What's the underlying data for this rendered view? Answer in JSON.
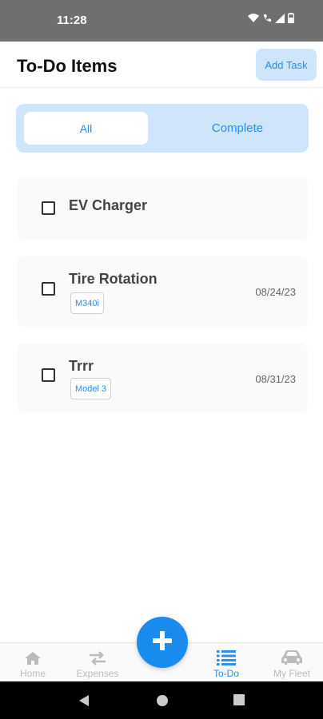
{
  "status_bar": {
    "time": "11:28"
  },
  "header": {
    "title": "To-Do Items",
    "add_task_label": "Add Task"
  },
  "filter": {
    "options": [
      "All",
      "Complete"
    ],
    "selected": "All"
  },
  "tasks": [
    {
      "title": "EV Charger",
      "tag": "",
      "date": "",
      "checked": false
    },
    {
      "title": "Tire Rotation",
      "tag": "M340i",
      "date": "08/24/23",
      "checked": false
    },
    {
      "title": "Trrr",
      "tag": "Model 3",
      "date": "08/31/23",
      "checked": false
    }
  ],
  "bottom_nav": {
    "items": [
      {
        "label": "Home",
        "icon": "home-icon",
        "active": false
      },
      {
        "label": "Expenses",
        "icon": "swap-arrows-icon",
        "active": false
      },
      {
        "label": "To-Do",
        "icon": "list-icon",
        "active": true
      },
      {
        "label": "My Fleet",
        "icon": "car-icon",
        "active": false
      }
    ],
    "fab_icon": "plus-icon"
  },
  "colors": {
    "accent": "#2d8cf0",
    "accent_light": "#cfe5fb",
    "fab": "#1a8cf0",
    "status_bar": "#6f6f6f"
  }
}
